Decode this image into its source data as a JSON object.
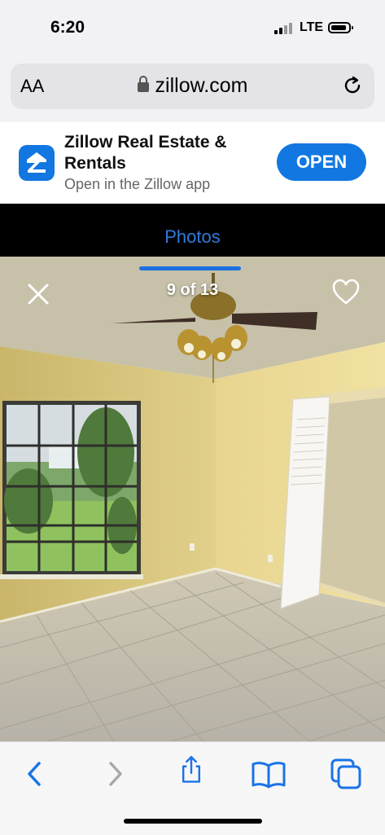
{
  "status": {
    "time": "6:20",
    "network": "LTE"
  },
  "browser": {
    "text_size_label": "AA",
    "url": "zillow.com"
  },
  "app_banner": {
    "title": "Zillow Real Estate & Rentals",
    "subtitle": "Open in the Zillow app",
    "open_label": "OPEN"
  },
  "gallery": {
    "tab_label": "Photos",
    "counter": "9 of 13"
  },
  "colors": {
    "accent": "#1277e1",
    "tab_text": "#2f7bd9",
    "header_bg": "#000000"
  },
  "icons": [
    "lock-icon",
    "reload-icon",
    "zillow-logo-icon",
    "close-icon",
    "heart-icon",
    "back-icon",
    "forward-icon",
    "share-icon",
    "bookmarks-icon",
    "tabs-icon"
  ]
}
